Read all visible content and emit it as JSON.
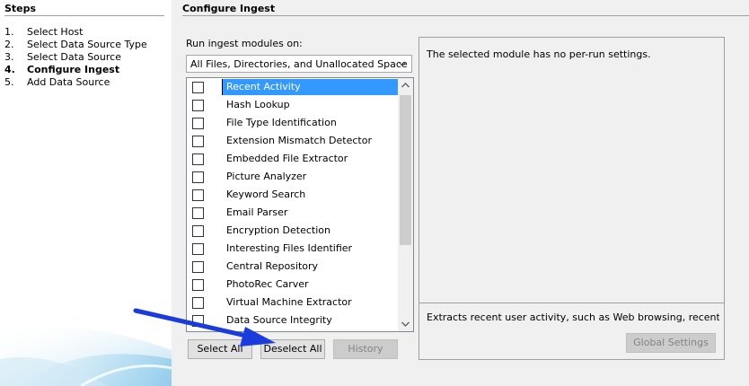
{
  "steps": {
    "title": "Steps",
    "items": [
      {
        "num": "1.",
        "label": "Select Host"
      },
      {
        "num": "2.",
        "label": "Select Data Source Type"
      },
      {
        "num": "3.",
        "label": "Select Data Source"
      },
      {
        "num": "4.",
        "label": "Configure Ingest"
      },
      {
        "num": "5.",
        "label": "Add Data Source"
      }
    ],
    "active_index": 3
  },
  "main": {
    "title": "Configure Ingest",
    "run_label": "Run ingest modules on:",
    "scope": {
      "selected": "All Files, Directories, and Unallocated Space"
    }
  },
  "modules": [
    {
      "label": "Recent Activity",
      "checked": false,
      "selected": true
    },
    {
      "label": "Hash Lookup",
      "checked": false,
      "selected": false
    },
    {
      "label": "File Type Identification",
      "checked": false,
      "selected": false
    },
    {
      "label": "Extension Mismatch Detector",
      "checked": false,
      "selected": false
    },
    {
      "label": "Embedded File Extractor",
      "checked": false,
      "selected": false
    },
    {
      "label": "Picture Analyzer",
      "checked": false,
      "selected": false
    },
    {
      "label": "Keyword Search",
      "checked": false,
      "selected": false
    },
    {
      "label": "Email Parser",
      "checked": false,
      "selected": false
    },
    {
      "label": "Encryption Detection",
      "checked": false,
      "selected": false
    },
    {
      "label": "Interesting Files Identifier",
      "checked": false,
      "selected": false
    },
    {
      "label": "Central Repository",
      "checked": false,
      "selected": false
    },
    {
      "label": "PhotoRec Carver",
      "checked": false,
      "selected": false
    },
    {
      "label": "Virtual Machine Extractor",
      "checked": false,
      "selected": false
    },
    {
      "label": "Data Source Integrity",
      "checked": false,
      "selected": false
    }
  ],
  "buttons": {
    "select_all": "Select All",
    "deselect_all": "Deselect All",
    "history": "History",
    "global_settings": "Global Settings"
  },
  "settings": {
    "message": "The selected module has no per-run settings.",
    "description": "Extracts recent user activity, such as Web browsing, recently us..."
  },
  "icons": {
    "dropdown": "chevron-down-icon",
    "scroll_up": "chevron-up-icon",
    "scroll_down": "chevron-down-icon",
    "annotation": "arrow-icon"
  },
  "colors": {
    "selection": "#3399ff",
    "annotation_arrow": "#1a3cdc"
  }
}
